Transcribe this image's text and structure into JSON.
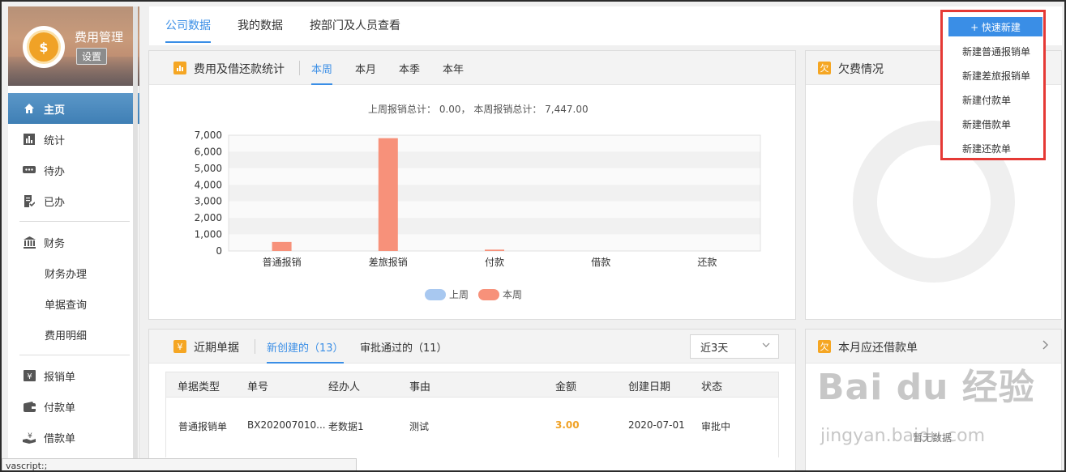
{
  "sidebar": {
    "brand_title": "费用管理",
    "brand_settings": "设置",
    "coin_glyph": "$",
    "items": [
      {
        "label": "主页",
        "icon": "home-icon"
      },
      {
        "label": "统计",
        "icon": "bar-chart-icon"
      },
      {
        "label": "待办",
        "icon": "chat-dots-icon"
      },
      {
        "label": "已办",
        "icon": "doc-check-icon"
      },
      {
        "label": "财务",
        "icon": "bank-icon"
      },
      {
        "label": "财务办理"
      },
      {
        "label": "单据查询"
      },
      {
        "label": "费用明细"
      },
      {
        "label": "报销单",
        "icon": "yen-card-icon"
      },
      {
        "label": "付款单",
        "icon": "wallet-icon"
      },
      {
        "label": "借款单",
        "icon": "hand-yen-icon"
      }
    ]
  },
  "top_tabs": [
    "公司数据",
    "我的数据",
    "按部门及人员查看"
  ],
  "stats_panel": {
    "title": "费用及借还款统计",
    "tabs": [
      "本周",
      "本月",
      "本季",
      "本年"
    ],
    "summary": "上周报销总计： 0.00， 本周报销总计： 7,447.00"
  },
  "chart_data": {
    "type": "bar",
    "categories": [
      "普通报销",
      "差旅报销",
      "付款",
      "借款",
      "还款"
    ],
    "series": [
      {
        "name": "上周",
        "values": [
          0,
          0,
          0,
          0,
          0
        ],
        "color": "#a8c8f0"
      },
      {
        "name": "本周",
        "values": [
          545,
          6820,
          82,
          0,
          0
        ],
        "color": "#f7917a"
      }
    ],
    "ylim": [
      0,
      7000
    ],
    "yticks": [
      "7,000",
      "6,000",
      "5,000",
      "4,000",
      "3,000",
      "2,000",
      "1,000",
      "0"
    ],
    "ytick_values": [
      7000,
      6000,
      5000,
      4000,
      3000,
      2000,
      1000,
      0
    ],
    "legend": "bottom"
  },
  "arrears_panel": {
    "title": "欠费情况",
    "icon_glyph": "欠"
  },
  "quick_new": {
    "button": "+ 快速新建",
    "items": [
      "新建普通报销单",
      "新建差旅报销单",
      "新建付款单",
      "新建借款单",
      "新建还款单"
    ]
  },
  "recent_panel": {
    "title": "近期单据",
    "icon_glyph": "¥",
    "tabs": [
      "新创建的（13）",
      "审批通过的（11）"
    ],
    "range_select": "近3天",
    "columns": [
      "单据类型",
      "单号",
      "经办人",
      "事由",
      "金额",
      "创建日期",
      "状态"
    ],
    "rows": [
      [
        "普通报销单",
        "BX202007010...",
        "老数据1",
        "测试",
        "3.00",
        "2020-07-01",
        "审批中"
      ]
    ]
  },
  "repay_panel": {
    "title": "本月应还借款单",
    "icon_glyph": "欠",
    "no_data": "暂无数据"
  },
  "statusbar": "vascript:;",
  "watermark": {
    "main": "Bai du 经验",
    "sub": "jingyan.baidu.com"
  }
}
